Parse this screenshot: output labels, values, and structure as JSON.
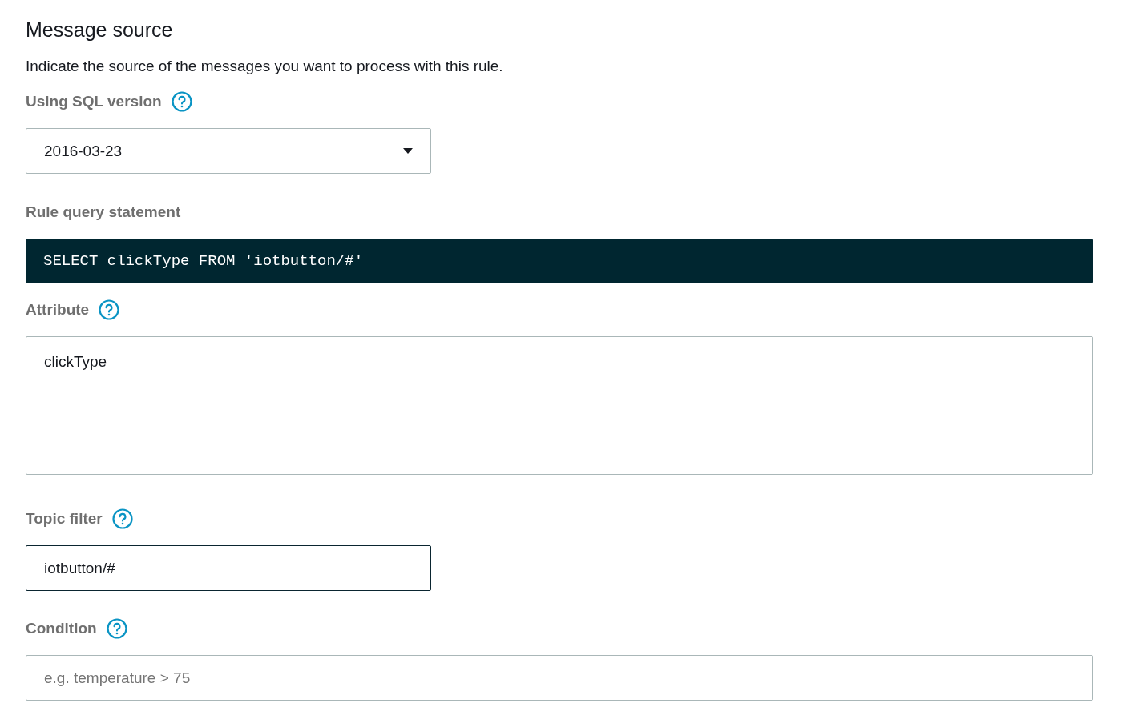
{
  "section": {
    "title": "Message source",
    "description": "Indicate the source of the messages you want to process with this rule."
  },
  "fields": [
    {
      "kind": "select",
      "label": "Using SQL version",
      "value": "2016-03-23",
      "focused": false
    },
    {
      "kind": "code",
      "label": "Rule query statement",
      "value": "SELECT clickType FROM 'iotbutton/#'"
    },
    {
      "kind": "textarea",
      "label": "Attribute",
      "value": "clickType",
      "focused": false
    },
    {
      "kind": "input",
      "label": "Topic filter",
      "value": "iotbutton/#",
      "focused": true
    },
    {
      "kind": "wide-input",
      "label": "Condition",
      "placeholder": "e.g. temperature > 75",
      "focused": false
    }
  ]
}
